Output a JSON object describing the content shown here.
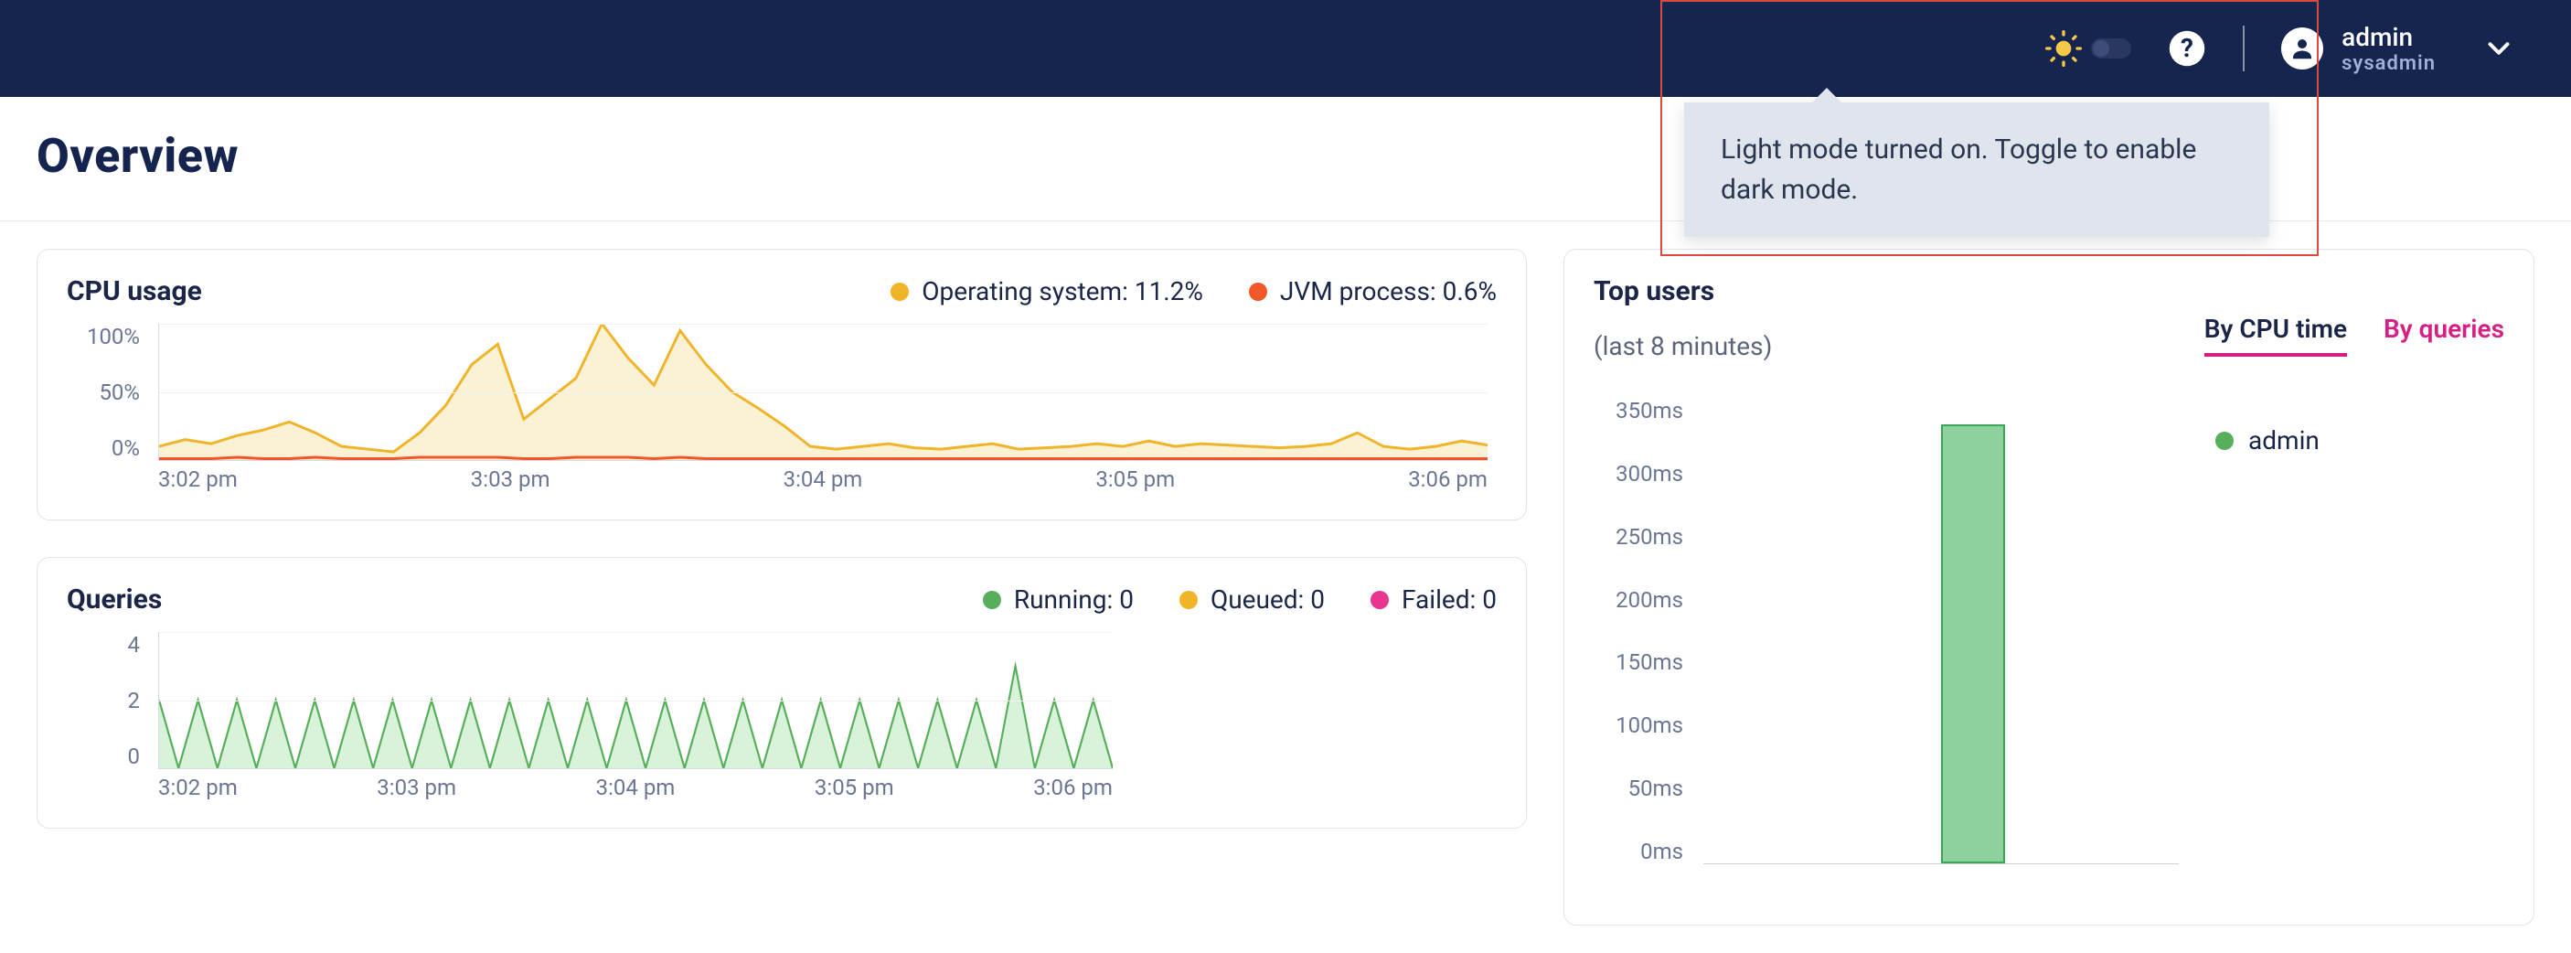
{
  "nav": {
    "tooltip": "Light mode turned on. Toggle to enable dark mode.",
    "user_name": "admin",
    "user_role": "sysadmin"
  },
  "page": {
    "title": "Overview"
  },
  "cpu_card": {
    "title": "CPU usage",
    "legend_os": "Operating system: 11.2%",
    "legend_jvm": "JVM process: 0.6%",
    "y_ticks": [
      "100%",
      "50%",
      "0%"
    ],
    "x_ticks": [
      "3:02 pm",
      "3:03 pm",
      "3:04 pm",
      "3:05 pm",
      "3:06 pm"
    ]
  },
  "queries_card": {
    "title": "Queries",
    "legend_running": "Running: 0",
    "legend_queued": "Queued: 0",
    "legend_failed": "Failed: 0",
    "y_ticks": [
      "4",
      "2",
      "0"
    ],
    "x_ticks": [
      "3:02 pm",
      "3:03 pm",
      "3:04 pm",
      "3:05 pm",
      "3:06 pm"
    ]
  },
  "users_card": {
    "title": "Top users",
    "subtitle": "(last 8 minutes)",
    "tab_cpu": "By CPU time",
    "tab_queries": "By queries",
    "y_ticks": [
      "350ms",
      "300ms",
      "250ms",
      "200ms",
      "150ms",
      "100ms",
      "50ms",
      "0ms"
    ],
    "legend_user": "admin"
  },
  "colors": {
    "os": "#f0b429",
    "jvm": "#f35627",
    "running": "#57ae5b",
    "queued": "#f0b429",
    "failed": "#e8368f",
    "bar_fill": "#8fd19e",
    "bar_stroke": "#3aa756",
    "accent": "#d61f84"
  },
  "chart_data": [
    {
      "id": "cpu_usage",
      "type": "line",
      "title": "CPU usage",
      "xlabel": "",
      "ylabel": "",
      "x": [
        "3:02 pm",
        "3:03 pm",
        "3:04 pm",
        "3:05 pm",
        "3:06 pm"
      ],
      "y_ticks_pct": [
        0,
        50,
        100
      ],
      "series": [
        {
          "name": "Operating system",
          "current_pct": 11.2,
          "color": "#f0b429",
          "values_pct": [
            10,
            15,
            12,
            18,
            22,
            28,
            20,
            10,
            8,
            6,
            20,
            40,
            70,
            85,
            30,
            45,
            60,
            100,
            75,
            55,
            95,
            70,
            50,
            38,
            25,
            10,
            8,
            10,
            12,
            9,
            8,
            10,
            12,
            8,
            9,
            10,
            12,
            10,
            14,
            10,
            12,
            11,
            10,
            9,
            10,
            12,
            20,
            10,
            8,
            10,
            14,
            11
          ]
        },
        {
          "name": "JVM process",
          "current_pct": 0.6,
          "color": "#f35627",
          "values_pct": [
            1,
            1,
            1,
            2,
            1,
            1,
            2,
            1,
            1,
            1,
            2,
            2,
            2,
            2,
            1,
            1,
            2,
            2,
            2,
            1,
            2,
            1,
            1,
            1,
            1,
            1,
            1,
            1,
            1,
            1,
            1,
            1,
            1,
            1,
            1,
            1,
            1,
            1,
            1,
            1,
            1,
            1,
            1,
            1,
            1,
            1,
            1,
            1,
            1,
            1,
            1,
            1
          ]
        }
      ]
    },
    {
      "id": "queries",
      "type": "line",
      "title": "Queries",
      "xlabel": "",
      "ylabel": "",
      "x": [
        "3:02 pm",
        "3:03 pm",
        "3:04 pm",
        "3:05 pm",
        "3:06 pm"
      ],
      "y_ticks": [
        0,
        2,
        4
      ],
      "series": [
        {
          "name": "Running",
          "current": 0,
          "color": "#57ae5b",
          "values": [
            2,
            0,
            2,
            0,
            2,
            0,
            2,
            0,
            2,
            0,
            2,
            0,
            2,
            0,
            2,
            0,
            2,
            0,
            2,
            0,
            2,
            0,
            2,
            0,
            2,
            0,
            2,
            0,
            2,
            0,
            2,
            0,
            2,
            0,
            2,
            0,
            2,
            0,
            2,
            0,
            2,
            0,
            2,
            0,
            3,
            0,
            2,
            0,
            2,
            0
          ]
        },
        {
          "name": "Queued",
          "current": 0,
          "color": "#f0b429",
          "values": []
        },
        {
          "name": "Failed",
          "current": 0,
          "color": "#e8368f",
          "values": []
        }
      ]
    },
    {
      "id": "top_users_cpu_time",
      "type": "bar",
      "title": "Top users by CPU time (last 8 minutes)",
      "ylabel": "CPU time",
      "ylim_ms": [
        0,
        350
      ],
      "categories": [
        "admin"
      ],
      "values_ms": [
        330
      ],
      "color": "#8fd19e"
    }
  ]
}
